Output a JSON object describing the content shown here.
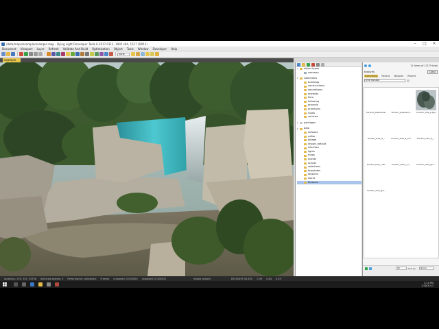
{
  "window": {
    "title": "/data/maps/example/example.map - Dying Light Developer Tools 6.2017.0112, 1905 x94, 1517 (DX11)",
    "minimize_glyph": "–",
    "maximize_glyph": "□",
    "close_glyph": "×"
  },
  "menu": [
    "Document",
    "Viewport",
    "Layer",
    "Refresh",
    "Validate And Build",
    "Optimization",
    "Object",
    "Tools",
    "Window",
    "Developer",
    "Help"
  ],
  "toolbar": {
    "zoom_value": "none"
  },
  "document_tab": "example",
  "object_tree": {
    "object_types": {
      "label": "object types",
      "children": [
        "common"
      ]
    },
    "collections": {
      "label": "collections",
      "children": [
        "buildings",
        "constructions",
        "decorations",
        "enemies",
        "flora",
        "following",
        "grounds",
        "primitives",
        "roads",
        "vehicles"
      ]
    },
    "packages": {
      "label": "packages"
    },
    "data": {
      "label": "data",
      "children": [
        "defaults",
        "editor",
        "foliage",
        "import_default",
        "interface",
        "lights",
        "maps",
        "quests",
        "scripts",
        "selections",
        "templates",
        "textures",
        "world"
      ]
    },
    "selected": "textures"
  },
  "asset_browser": {
    "item_count": "12 items of 12179 total",
    "section_label": "textures",
    "clear_label": "Clear",
    "tabs": [
      "Everything",
      "Recent",
      "Textures",
      "Recent"
    ],
    "active_tab": 0,
    "filter_value": "tree horizon",
    "items": [
      {
        "name": "horizon_pl4boards...",
        "has_thumb": false
      },
      {
        "name": "horizon_pl4board...",
        "has_thumb": false
      },
      {
        "name": "horizon_tree_p.tga",
        "has_thumb": true
      },
      {
        "name": "horizon_tree_4_...",
        "has_thumb": false
      },
      {
        "name": "horizon_tree_4_nor.",
        "has_thumb": false
      },
      {
        "name": "horizon_tree_4_...",
        "has_thumb": false
      },
      {
        "name": "horizon_tree_c.tif...",
        "has_thumb": false
      },
      {
        "name": "horizon_tree_c_n...",
        "has_thumb": false
      },
      {
        "name": "horizon_tree_gro...",
        "has_thumb": false
      },
      {
        "name": "horizon_tree_gro...",
        "has_thumb": false
      }
    ],
    "size_value": "96",
    "sort_label": "Sort by",
    "sort_value": "Name"
  },
  "status": [
    "locations: 176, 335, 34758",
    "Selected objects: 0",
    "Performance: automatic",
    "Frames",
    "unloaded: 0.000000",
    "unloaded: 0.000000",
    "Visible objects",
    "85500495 94-ESS",
    "0.39",
    "0.84",
    "0.39"
  ],
  "taskbar": {
    "time": "1:14 PM",
    "date": "1/18/2017"
  },
  "colors": {
    "accent": "#e7c64b",
    "selection": "#a9c4ea",
    "folder": "#e3b94a",
    "statusbar": "#2b2b2b"
  }
}
